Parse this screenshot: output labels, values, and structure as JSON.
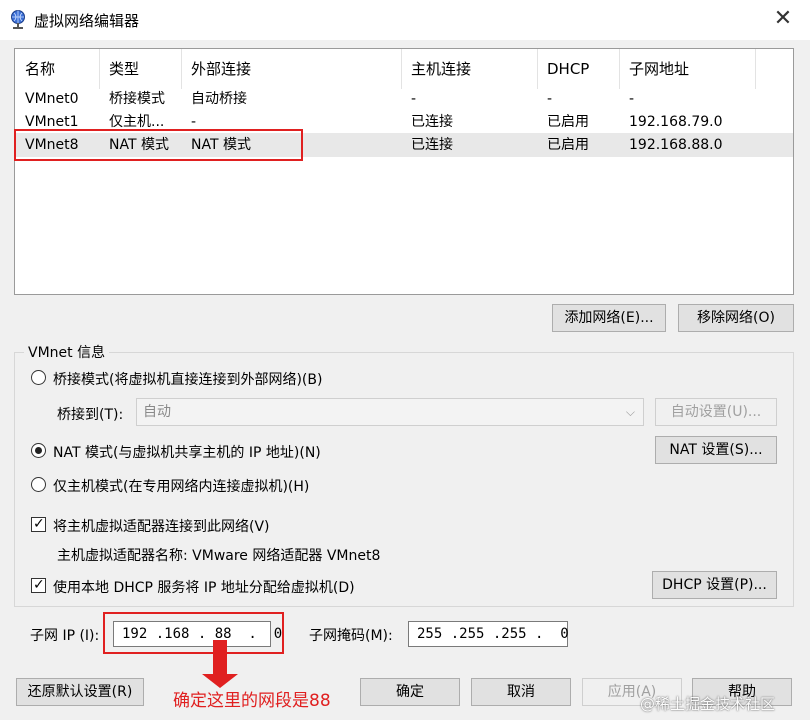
{
  "window": {
    "title": "虚拟网络编辑器",
    "close_glyph": "✕"
  },
  "table": {
    "headers": [
      "名称",
      "类型",
      "外部连接",
      "主机连接",
      "DHCP",
      "子网地址"
    ],
    "rows": [
      [
        "VMnet0",
        "桥接模式",
        "自动桥接",
        "-",
        "-",
        "-"
      ],
      [
        "VMnet1",
        "仅主机...",
        "-",
        "已连接",
        "已启用",
        "192.168.79.0"
      ],
      [
        "VMnet8",
        "NAT 模式",
        "NAT 模式",
        "已连接",
        "已启用",
        "192.168.88.0"
      ]
    ],
    "selected_row": "VMnet8"
  },
  "buttons": {
    "add_network": "添加网络(E)...",
    "remove_network": "移除网络(O)",
    "auto_settings": "自动设置(U)...",
    "nat_settings": "NAT 设置(S)...",
    "dhcp_settings": "DHCP 设置(P)...",
    "restore_defaults": "还原默认设置(R)",
    "ok": "确定",
    "cancel": "取消",
    "apply": "应用(A)",
    "help": "帮助"
  },
  "vmnet_info": {
    "group_label": "VMnet 信息",
    "bridged_radio": "桥接模式(将虚拟机直接连接到外部网络)(B)",
    "bridge_to_label": "桥接到(T):",
    "bridge_to_value": "自动",
    "nat_radio": "NAT 模式(与虚拟机共享主机的 IP 地址)(N)",
    "host_only_radio": "仅主机模式(在专用网络内连接虚拟机)(H)",
    "selected_mode": "nat",
    "connect_adapter_checkbox": "将主机虚拟适配器连接到此网络(V)",
    "connect_adapter_checked": true,
    "adapter_name_text": "主机虚拟适配器名称: VMware 网络适配器 VMnet8",
    "use_dhcp_checkbox": "使用本地 DHCP 服务将 IP 地址分配给虚拟机(D)",
    "use_dhcp_checked": true,
    "subnet_ip_label": "子网 IP (I):",
    "subnet_ip_value": "192 .168 . 88  .  0",
    "subnet_mask_label": "子网掩码(M):",
    "subnet_mask_value": "255 .255 .255 .  0"
  },
  "annotation": {
    "text": "确定这里的网段是88",
    "color": "#e02020"
  },
  "watermark": "@稀土掘金技术社区",
  "icons": {
    "app": "network-globe-icon",
    "close": "close-icon",
    "combo_arrow": "chevron-down-icon"
  }
}
